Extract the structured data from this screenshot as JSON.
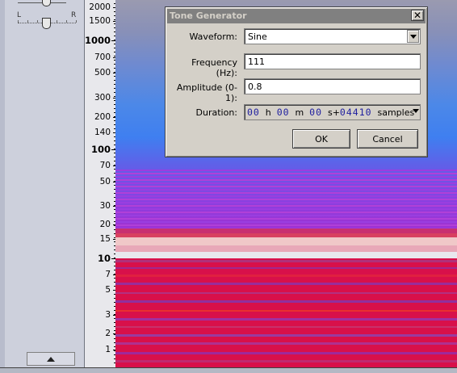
{
  "track_panel": {
    "pan_left": "L",
    "pan_right": "R"
  },
  "ruler": {
    "labels": [
      {
        "text": "2000",
        "bold": false
      },
      {
        "text": "1500",
        "bold": false
      },
      {
        "text": "1000",
        "bold": true
      },
      {
        "text": "700",
        "bold": false
      },
      {
        "text": "500",
        "bold": false
      },
      {
        "text": "300",
        "bold": false
      },
      {
        "text": "200",
        "bold": false
      },
      {
        "text": "140",
        "bold": false
      },
      {
        "text": "100",
        "bold": true
      },
      {
        "text": "70",
        "bold": false
      },
      {
        "text": "50",
        "bold": false
      },
      {
        "text": "30",
        "bold": false
      },
      {
        "text": "20",
        "bold": false
      },
      {
        "text": "15",
        "bold": false
      },
      {
        "text": "10",
        "bold": true
      },
      {
        "text": "7",
        "bold": false
      },
      {
        "text": "5",
        "bold": false
      },
      {
        "text": "3",
        "bold": false
      },
      {
        "text": "2",
        "bold": false
      },
      {
        "text": "1",
        "bold": false
      }
    ]
  },
  "dialog": {
    "title": "Tone Generator",
    "close": "✕",
    "waveform_label": "Waveform:",
    "waveform_value": "Sine",
    "frequency_label": "Frequency (Hz):",
    "frequency_value": "111",
    "amplitude_label": "Amplitude (0-1):",
    "amplitude_value": "0.8",
    "duration_label": "Duration:",
    "duration": {
      "hours": "00",
      "h": "h",
      "minutes": "00",
      "m": "m",
      "seconds": "00",
      "s": "s+",
      "samples": "04410",
      "unit": "samples"
    },
    "ok": "OK",
    "cancel": "Cancel"
  }
}
